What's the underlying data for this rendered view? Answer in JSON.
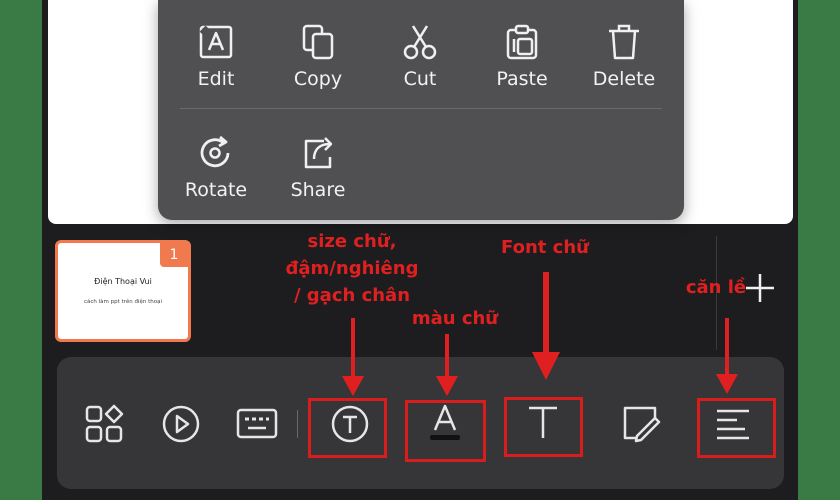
{
  "context_menu": {
    "items": [
      {
        "label": "Edit",
        "icon": "edit-text-icon"
      },
      {
        "label": "Copy",
        "icon": "copy-icon"
      },
      {
        "label": "Cut",
        "icon": "scissors-icon"
      },
      {
        "label": "Paste",
        "icon": "paste-icon"
      },
      {
        "label": "Delete",
        "icon": "trash-icon"
      },
      {
        "label": "Rotate",
        "icon": "rotate-icon"
      },
      {
        "label": "Share",
        "icon": "share-icon"
      }
    ]
  },
  "thumbnail": {
    "number": "1",
    "title": "Điện Thoại Vui",
    "subtitle": "cách làm ppt trên điện thoại",
    "accent": "#f07a4e"
  },
  "annotations": {
    "size": "size chữ,\nđậm/nghiêng\n/ gạch chân",
    "color": "màu chữ",
    "font": "Font chữ",
    "align": "căn lề",
    "color_hex": "#e02020"
  },
  "toolbar": {
    "icons": [
      "layout-icon",
      "play-icon",
      "keyboard-icon",
      "text-style-icon",
      "font-color-icon",
      "font-icon",
      "draw-icon",
      "align-left-icon"
    ]
  }
}
